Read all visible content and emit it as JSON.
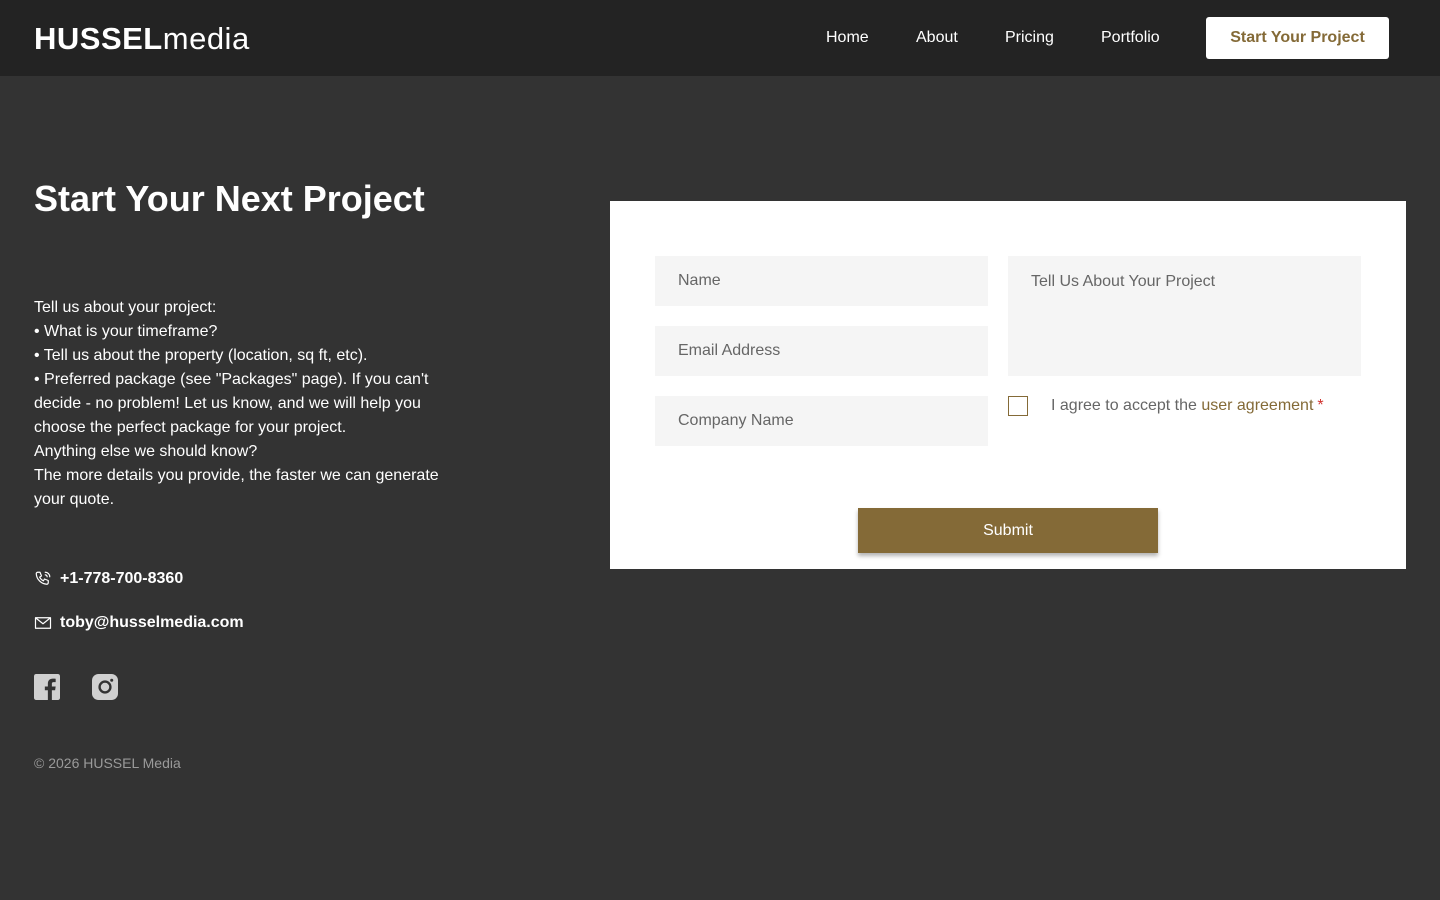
{
  "brand": {
    "bold": "HUSSEL",
    "light": "media"
  },
  "nav": {
    "home": "Home",
    "about": "About",
    "pricing": "Pricing",
    "portfolio": "Portfolio",
    "cta": "Start Your Project"
  },
  "hero": {
    "heading": "Start Your Next Project",
    "lines": [
      "Tell us about your project:",
      "• What is your timeframe?",
      "• Tell us about the property (location, sq ft, etc).",
      "• Preferred package (see \"Packages\" page). If you can't decide - no problem! Let us know, and we will help you choose the perfect package for your project.",
      "Anything else we should know?",
      "The more details you provide, the faster we can generate your quote."
    ]
  },
  "contact": {
    "phone": "+1-778-700-8360",
    "email": "toby@husselmedia.com"
  },
  "social": {
    "icons": [
      "facebook-icon",
      "instagram-icon"
    ]
  },
  "footer": {
    "copyright": "© 2026 HUSSEL Media"
  },
  "form": {
    "name_placeholder": "Name",
    "email_placeholder": "Email Address",
    "company_placeholder": "Company Name",
    "project_placeholder": "Tell Us About Your Project",
    "agree_text": "I agree to accept the ",
    "agree_link": "user agreement",
    "required_mark": "*",
    "submit_label": "Submit"
  },
  "colors": {
    "accent": "#846a37",
    "background": "#333333",
    "header": "#232323",
    "field": "#f5f5f5",
    "required": "#d0312d"
  }
}
